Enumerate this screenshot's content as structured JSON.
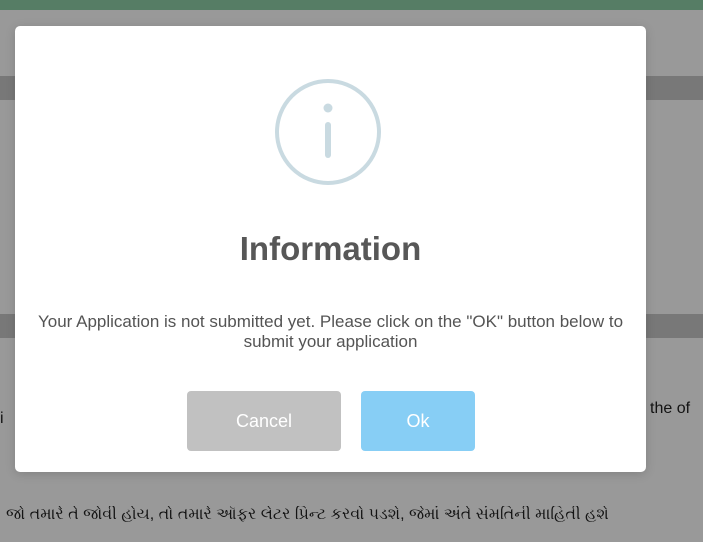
{
  "background": {
    "right_fragment": "the of",
    "left_fragment": "i",
    "gujarati_line": "જો તમારે તે જોવી હોય, તો તમારે ઑફર લેટર પ્રિન્ટ કરવો પડશે, જેમાં અંતે સંમતિની માહિતી હશે"
  },
  "dialog": {
    "icon": "info-icon",
    "title": "Information",
    "message": "Your Application is not submitted yet. Please click on the \"OK\" button below to submit your application",
    "cancel_label": "Cancel",
    "ok_label": "Ok"
  },
  "colors": {
    "title": "#575757",
    "message": "#545454",
    "icon_ring": "#c9dae1",
    "cancel_button": "#c1c1c1",
    "ok_button": "#87cef5",
    "overlay": "rgba(0,0,0,0.40)"
  }
}
